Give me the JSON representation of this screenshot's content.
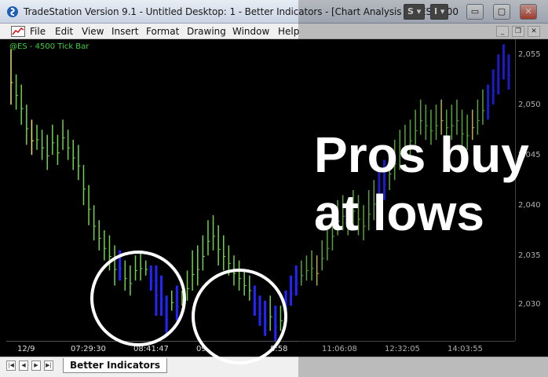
{
  "window": {
    "title": "TradeStation Version 9.1 - Untitled Desktop: 1 - Better Indicators - [Chart Analysis - @ES 4500",
    "drop_s": "S",
    "drop_i": "I",
    "minimize": "▭",
    "restore": "▢",
    "close": "✕"
  },
  "menu": {
    "items": [
      "File",
      "Edit",
      "View",
      "Insert",
      "Format",
      "Drawing",
      "Window",
      "Help"
    ]
  },
  "chart": {
    "symbol_label": "@ES - 4500 Tick Bar",
    "price_ticks": [
      "2,055",
      "2,050",
      "2,045",
      "2,040",
      "2,035",
      "2,030"
    ],
    "time_ticks": [
      "12/9",
      "07:29:30",
      "08:41:47",
      "09",
      "8:58",
      "11:06:08",
      "12:32:05",
      "14:03:55"
    ]
  },
  "chart_data": {
    "type": "bar",
    "title": "@ES - 4500 Tick Bar",
    "ylim": [
      2026.5,
      2056.5
    ],
    "colors": {
      "green": "#6fd24a",
      "blue": "#2424ff",
      "yellow": "#f0e04a"
    },
    "bars": [
      [
        2055.5,
        2050.0,
        "y"
      ],
      [
        2053.0,
        2049.5,
        "g"
      ],
      [
        2052.0,
        2048.0,
        "g"
      ],
      [
        2050.0,
        2046.0,
        "g"
      ],
      [
        2048.5,
        2045.0,
        "y"
      ],
      [
        2048.0,
        2045.5,
        "g"
      ],
      [
        2047.5,
        2044.5,
        "g"
      ],
      [
        2047.0,
        2043.5,
        "g"
      ],
      [
        2048.0,
        2045.0,
        "g"
      ],
      [
        2047.0,
        2044.0,
        "g"
      ],
      [
        2048.5,
        2045.5,
        "g"
      ],
      [
        2047.5,
        2044.5,
        "g"
      ],
      [
        2046.5,
        2043.5,
        "g"
      ],
      [
        2046.0,
        2042.5,
        "g"
      ],
      [
        2044.0,
        2040.0,
        "g"
      ],
      [
        2042.0,
        2038.0,
        "g"
      ],
      [
        2040.0,
        2036.5,
        "g"
      ],
      [
        2038.5,
        2035.5,
        "g"
      ],
      [
        2037.5,
        2034.5,
        "g"
      ],
      [
        2037.0,
        2033.5,
        "g"
      ],
      [
        2036.0,
        2032.0,
        "g"
      ],
      [
        2035.5,
        2032.5,
        "b"
      ],
      [
        2034.5,
        2031.5,
        "g"
      ],
      [
        2034.0,
        2031.0,
        "g"
      ],
      [
        2035.0,
        2032.5,
        "g"
      ],
      [
        2035.5,
        2032.5,
        "g"
      ],
      [
        2034.5,
        2033.0,
        "g"
      ],
      [
        2034.0,
        2031.5,
        "b"
      ],
      [
        2034.0,
        2029.0,
        "b"
      ],
      [
        2033.0,
        2029.0,
        "b"
      ],
      [
        2031.0,
        2027.0,
        "b"
      ],
      [
        2031.5,
        2029.5,
        "g"
      ],
      [
        2032.0,
        2028.5,
        "b"
      ],
      [
        2031.5,
        2030.0,
        "g"
      ],
      [
        2033.5,
        2030.5,
        "g"
      ],
      [
        2035.5,
        2031.5,
        "g"
      ],
      [
        2036.0,
        2032.0,
        "g"
      ],
      [
        2037.0,
        2033.5,
        "g"
      ],
      [
        2038.5,
        2035.0,
        "g"
      ],
      [
        2039.0,
        2035.5,
        "g"
      ],
      [
        2038.0,
        2034.0,
        "g"
      ],
      [
        2037.0,
        2033.5,
        "g"
      ],
      [
        2036.0,
        2033.0,
        "g"
      ],
      [
        2035.0,
        2032.0,
        "g"
      ],
      [
        2034.5,
        2031.5,
        "g"
      ],
      [
        2033.5,
        2031.0,
        "g"
      ],
      [
        2033.0,
        2030.5,
        "g"
      ],
      [
        2032.0,
        2029.0,
        "b"
      ],
      [
        2031.0,
        2028.0,
        "b"
      ],
      [
        2030.5,
        2027.0,
        "b"
      ],
      [
        2031.0,
        2027.5,
        "g"
      ],
      [
        2030.0,
        2026.5,
        "b"
      ],
      [
        2030.0,
        2027.5,
        "g"
      ],
      [
        2031.5,
        2028.5,
        "b"
      ],
      [
        2033.0,
        2030.0,
        "b"
      ],
      [
        2034.0,
        2031.0,
        "b"
      ],
      [
        2034.5,
        2032.0,
        "g"
      ],
      [
        2035.0,
        2032.5,
        "g"
      ],
      [
        2035.5,
        2032.5,
        "g"
      ],
      [
        2035.0,
        2032.0,
        "y"
      ],
      [
        2036.5,
        2033.5,
        "g"
      ],
      [
        2037.5,
        2034.5,
        "g"
      ],
      [
        2039.0,
        2035.5,
        "g"
      ],
      [
        2040.5,
        2037.0,
        "g"
      ],
      [
        2041.0,
        2037.5,
        "g"
      ],
      [
        2040.5,
        2037.0,
        "g"
      ],
      [
        2041.5,
        2038.0,
        "g"
      ],
      [
        2041.0,
        2037.0,
        "g"
      ],
      [
        2040.0,
        2036.5,
        "g"
      ],
      [
        2041.5,
        2037.5,
        "g"
      ],
      [
        2042.5,
        2038.5,
        "g"
      ],
      [
        2043.5,
        2039.5,
        "b"
      ],
      [
        2044.5,
        2040.5,
        "b"
      ],
      [
        2045.5,
        2041.5,
        "g"
      ],
      [
        2046.5,
        2042.5,
        "g"
      ],
      [
        2047.5,
        2043.5,
        "g"
      ],
      [
        2048.0,
        2044.5,
        "g"
      ],
      [
        2048.5,
        2045.0,
        "g"
      ],
      [
        2049.5,
        2046.0,
        "g"
      ],
      [
        2050.5,
        2047.0,
        "g"
      ],
      [
        2050.0,
        2046.5,
        "g"
      ],
      [
        2049.5,
        2046.0,
        "g"
      ],
      [
        2050.0,
        2046.5,
        "g"
      ],
      [
        2050.5,
        2047.0,
        "y"
      ],
      [
        2049.5,
        2046.5,
        "g"
      ],
      [
        2050.0,
        2046.5,
        "g"
      ],
      [
        2050.5,
        2047.0,
        "g"
      ],
      [
        2049.5,
        2045.5,
        "g"
      ],
      [
        2049.0,
        2045.5,
        "g"
      ],
      [
        2049.5,
        2046.5,
        "y"
      ],
      [
        2050.5,
        2047.0,
        "g"
      ],
      [
        2051.5,
        2048.0,
        "g"
      ],
      [
        2052.0,
        2048.5,
        "b"
      ],
      [
        2053.5,
        2050.0,
        "b"
      ],
      [
        2055.0,
        2051.0,
        "b"
      ],
      [
        2056.0,
        2052.5,
        "b"
      ],
      [
        2055.0,
        2051.5,
        "b"
      ]
    ]
  },
  "overlay": {
    "line1": "Pros buy",
    "line2": "at lows"
  },
  "tabs": {
    "active": "Better Indicators",
    "nav": [
      "|◀",
      "◀",
      "▶",
      "▶|"
    ]
  }
}
